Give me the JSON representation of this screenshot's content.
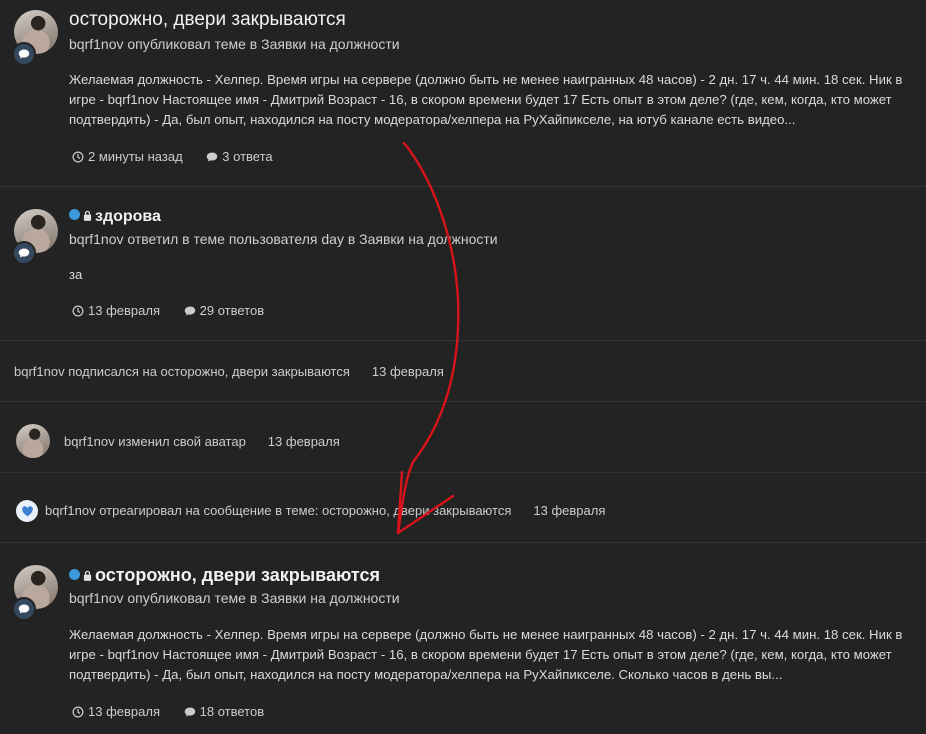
{
  "items": [
    {
      "title": "осторожно, двери закрываются",
      "subline": "bqrf1nov опубликовал теме в Заявки на должности",
      "snippet": "Желаемая должность - Хелпер. Время игры на сервере (должно быть не менее наигранных 48 часов) - 2 дн. 17 ч. 44 мин. 18 сек. Ник в игре - bqrf1nov Настоящее имя - Дмитрий Возраст - 16, в скором времени будет 17 Есть опыт в этом деле? (где, кем, когда, кто может подтвердить) - Да, был опыт, находился на посту модератора/хелпера на РуХайпикселе, на ютуб канале есть видео...",
      "time": "2 минуты назад",
      "replies": "3 ответа"
    },
    {
      "title": "здорова",
      "subline": "bqrf1nov ответил в теме пользователя day в Заявки на должности",
      "snippet": "за",
      "time": "13 февраля",
      "replies": "29 ответов"
    },
    {
      "text": "bqrf1nov подписался на осторожно, двери закрываются",
      "date": "13 февраля"
    },
    {
      "text": "bqrf1nov изменил свой аватар",
      "date": "13 февраля"
    },
    {
      "text": "bqrf1nov отреагировал на сообщение в теме: осторожно, двери закрываются",
      "date": "13 февраля"
    },
    {
      "title": "осторожно, двери закрываются",
      "subline": "bqrf1nov опубликовал теме в Заявки на должности",
      "snippet": "Желаемая должность - Хелпер. Время игры на сервере (должно быть не менее наигранных 48 часов) - 2 дн. 17 ч. 44 мин. 18 сек. Ник в игре - bqrf1nov Настоящее имя - Дмитрий Возраст - 16, в скором времени будет 17 Есть опыт в этом деле? (где, кем, когда, кто может подтвердить) - Да, был опыт, находился на посту модератора/хелпера на РуХайпикселе. Сколько часов в день вы...",
      "time": "13 февраля",
      "replies": "18 ответов"
    }
  ],
  "colors": {
    "background": "#232323",
    "unread_dot": "#3a9ad9",
    "badge": "#34495e",
    "annotation_arrow": "#d8141a"
  },
  "icons": {
    "post_type": "comment-icon",
    "time": "clock-icon",
    "replies": "comment-icon",
    "locked": "lock-icon",
    "reaction": "heart-icon"
  }
}
